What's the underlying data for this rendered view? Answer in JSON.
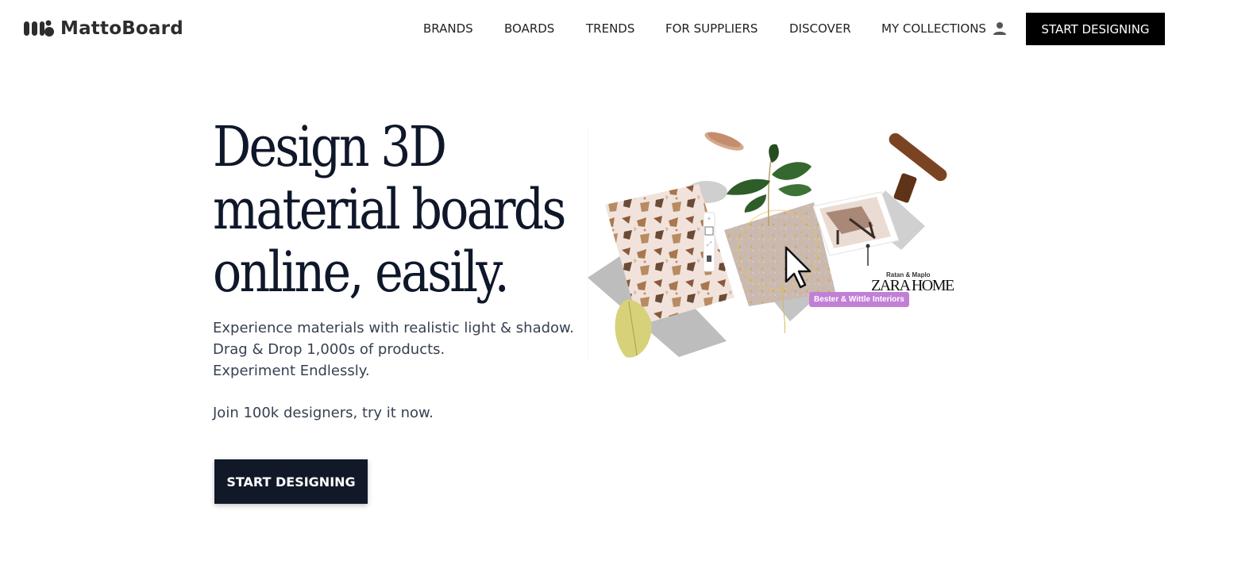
{
  "header": {
    "logo_text": "MattoBoard",
    "nav": [
      "BRANDS",
      "BOARDS",
      "TRENDS",
      "FOR SUPPLIERS",
      "DISCOVER",
      "MY COLLECTIONS"
    ],
    "cta_label": "START DESIGNING"
  },
  "hero": {
    "title_lines": [
      "Design 3D",
      "material boards",
      "online, easily."
    ],
    "sub_lines": [
      "Experience materials with realistic light & shadow.",
      "Drag & Drop 1,000s of products.",
      "Experiment Endlessly."
    ],
    "join_text": "Join 100k designers, try it now.",
    "cta_label": "START DESIGNING"
  },
  "illustration": {
    "tag_bester": "Bester & Wittle Interiors",
    "tag_ratan": "Ratan & Maplo",
    "tag_zara": "ZARA HOME"
  },
  "colors": {
    "hero_cta_bg": "#111827",
    "header_cta_bg": "#000000",
    "title": "#0f172a",
    "tag_bester": "#c27fd6"
  }
}
